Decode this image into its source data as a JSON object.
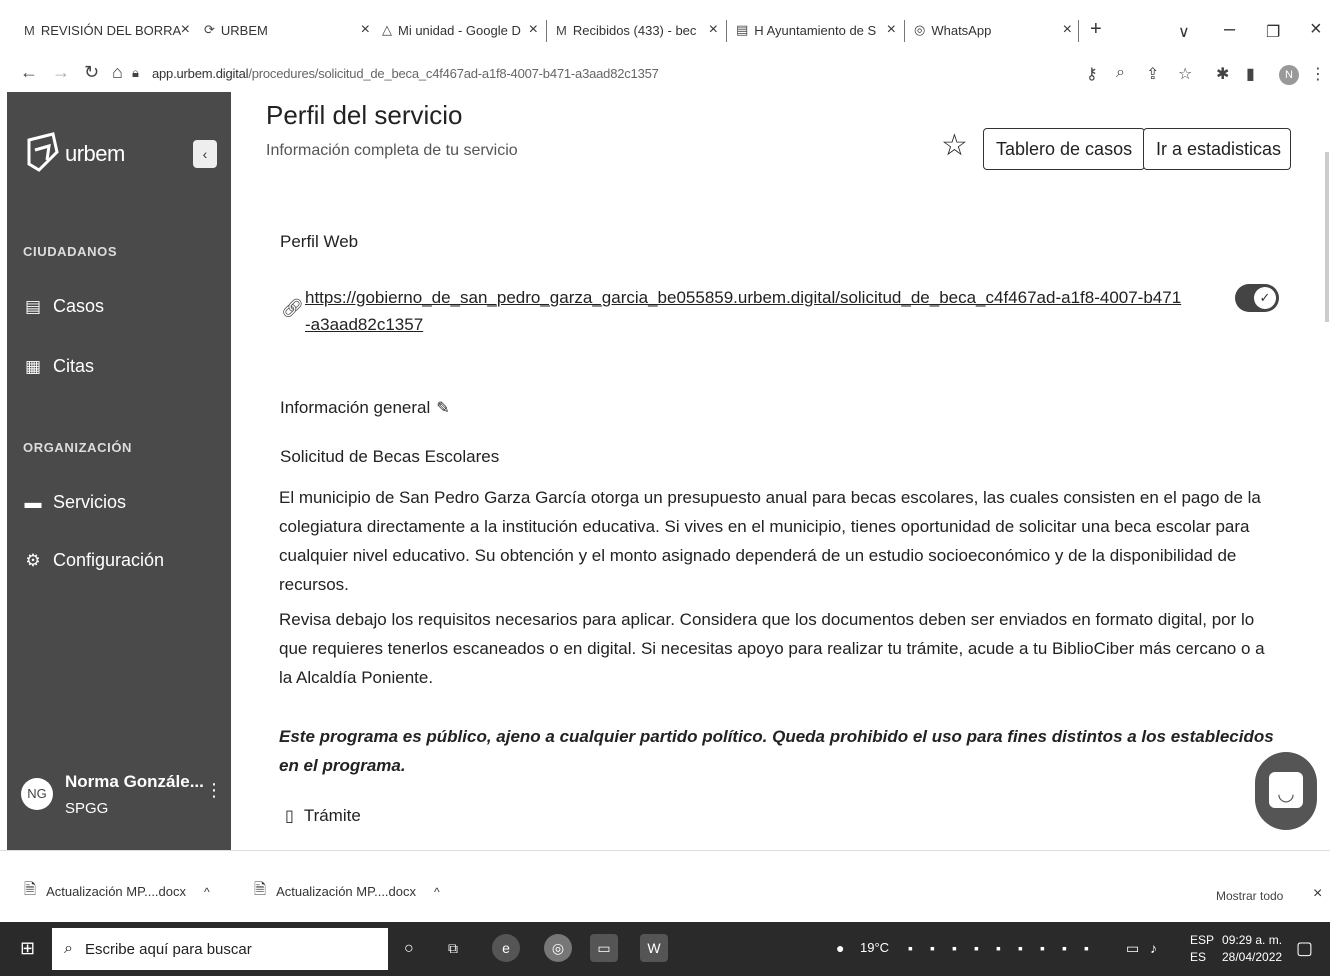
{
  "browser": {
    "tabs": [
      {
        "icon": "M",
        "label": "REVISIÓN DEL BORRA"
      },
      {
        "icon": "⟳",
        "label": "URBEM"
      },
      {
        "icon": "△",
        "label": "Mi unidad - Google D"
      },
      {
        "icon": "M",
        "label": "Recibidos (433) - bec"
      },
      {
        "icon": "▤",
        "label": "H Ayuntamiento de S"
      },
      {
        "icon": "◎",
        "label": "WhatsApp"
      }
    ],
    "new_tab": "+",
    "url_host": "app.urbem.digital",
    "url_path": "/procedures/solicitud_de_beca_c4f467ad-a1f8-4007-b471-a3aad82c1357",
    "profile_initial": "N"
  },
  "sidebar": {
    "brand": "urbem",
    "collapse": "‹",
    "section_citizens": "CIUDADANOS",
    "section_org": "ORGANIZACIÓN",
    "items": [
      {
        "label": "Casos",
        "icon": "document-icon"
      },
      {
        "label": "Citas",
        "icon": "calendar-icon"
      },
      {
        "label": "Servicios",
        "icon": "folder-icon"
      },
      {
        "label": "Configuración",
        "icon": "gear-icon"
      }
    ],
    "user": {
      "initials": "NG",
      "name": "Norma Gonzále...",
      "org": "SPGG"
    }
  },
  "main": {
    "title": "Perfil del servicio",
    "subtitle": "Información completa de tu servicio",
    "btn_cases_board": "Tablero de casos",
    "btn_stats": "Ir a estadisticas",
    "web_profile_heading": "Perfil Web",
    "web_profile_url": "https://gobierno_de_san_pedro_garza_garcia_be055859.urbem.digital/solicitud_de_beca_c4f467ad-a1f8-4007-b471-a3aad82c1357",
    "web_profile_enabled": true,
    "general_info_heading": "Información general",
    "service_name": "Solicitud de Becas Escolares",
    "description_p1": "El municipio de San Pedro Garza García otorga un presupuesto anual para becas escolares, las cuales  consisten en el pago de la colegiatura directamente a la institución educativa. Si vives en el municipio, tienes oportunidad de solicitar una beca escolar para cualquier nivel educativo. Su obtención y el monto asignado dependerá de un estudio socioeconómico y de la disponibilidad de recursos.",
    "description_p2": "Revisa debajo los requisitos necesarios para aplicar. Considera que los documentos deben ser enviados en formato digital, por lo que requieres tenerlos escaneados o en digital. Si necesitas apoyo para realizar tu trámite, acude a tu BiblioCiber más cercano o a la Alcaldía Poniente.",
    "notice": "Este programa es público, ajeno a cualquier partido político. Queda prohibido el uso para fines distintos a los establecidos en el programa.",
    "tramite_label": "Trámite"
  },
  "downloads": {
    "items": [
      "Actualización MP....docx",
      "Actualización MP....docx"
    ],
    "show_all": "Mostrar todo"
  },
  "taskbar": {
    "search_placeholder": "Escribe aquí para buscar",
    "temperature": "19°C",
    "lang_top": "ESP",
    "lang_bottom": "ES",
    "time": "09:29 a. m.",
    "date": "28/04/2022"
  }
}
